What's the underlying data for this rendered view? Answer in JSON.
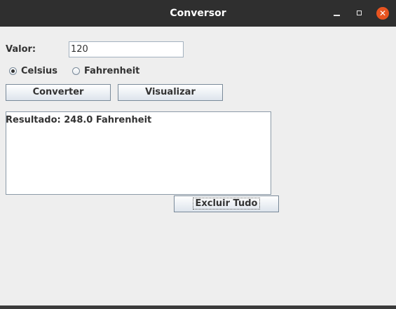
{
  "window": {
    "title": "Conversor",
    "minimize_glyph": "",
    "close_glyph": "✕"
  },
  "form": {
    "value_label": "Valor:",
    "value_input": "120",
    "unit_options": [
      {
        "label": "Celsius",
        "selected": true
      },
      {
        "label": "Fahrenheit",
        "selected": false
      }
    ],
    "convert_button": "Converter",
    "view_button": "Visualizar",
    "result_text": "Resultado: 248.0 Fahrenheit",
    "clear_button": "Excluir Tudo"
  },
  "colors": {
    "titlebar": "#2f2f2f",
    "close_button": "#e95420",
    "window_bg": "#eeeeee"
  }
}
